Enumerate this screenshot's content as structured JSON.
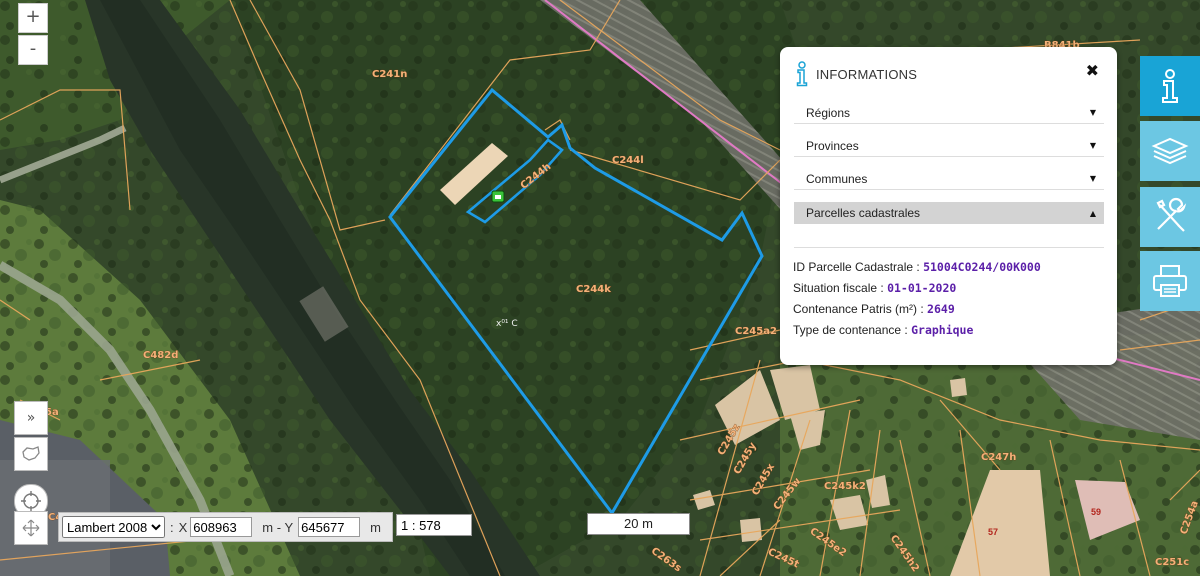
{
  "map": {
    "parcel_labels": [
      "C241n",
      "C244l",
      "C244h",
      "C244k",
      "C245a2",
      "C482d",
      "B841b",
      "C245z",
      "C245y",
      "C245x",
      "C245w",
      "C245k2",
      "C247h",
      "C245e2",
      "C245h2",
      "C245t",
      "C263s",
      "C254a",
      "C251c",
      "C4",
      "5a"
    ],
    "building_numbers": [
      "57",
      "59"
    ],
    "center_marker": "x⁰¹ C",
    "selected_parcel_color": "#1e9be6",
    "parcel_line_color": "#e8a75c"
  },
  "zoom": {
    "in_label": "+",
    "out_label": "-"
  },
  "side_tools": {
    "expand_label": "»"
  },
  "coordinates": {
    "system_options": [
      "Lambert 2008"
    ],
    "system_selected": "Lambert 2008",
    "sep_label": ":",
    "x_label": "X",
    "x_value": "608963",
    "mid_label": "m - Y",
    "y_value": "645677",
    "unit_label": "m",
    "scale_value": "1 : 578"
  },
  "scalebar": {
    "label": "20 m"
  },
  "info_panel": {
    "title": "INFORMATIONS",
    "close_label": "✖",
    "sections": [
      {
        "label": "Régions",
        "expanded": false
      },
      {
        "label": "Provinces",
        "expanded": false
      },
      {
        "label": "Communes",
        "expanded": false
      },
      {
        "label": "Parcelles cadastrales",
        "expanded": true
      }
    ],
    "caret_down": "▼",
    "caret_up": "▲",
    "details": [
      {
        "label": "ID Parcelle Cadastrale : ",
        "value": "51004C0244/00K000"
      },
      {
        "label": "Situation fiscale : ",
        "value": "01-01-2020"
      },
      {
        "label": "Contenance Patris (m²) : ",
        "value": "2649"
      },
      {
        "label": "Type de contenance : ",
        "value": "Graphique"
      }
    ],
    "accent_color": "#1aa3d5"
  },
  "right_toolbar": {
    "buttons": [
      "info",
      "layers",
      "tools",
      "print"
    ],
    "color_active": "#19a4d6",
    "color_inactive": "#6cc7e3"
  }
}
